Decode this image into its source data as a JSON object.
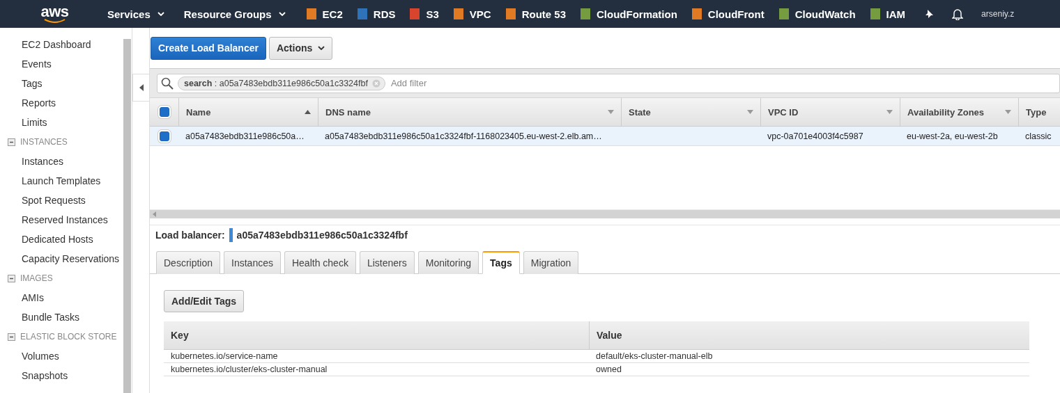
{
  "top_nav": {
    "logo": "aws",
    "menus": [
      {
        "label": "Services"
      },
      {
        "label": "Resource Groups"
      }
    ],
    "services": [
      {
        "label": "EC2",
        "color": "#e07b24"
      },
      {
        "label": "RDS",
        "color": "#2e73b8"
      },
      {
        "label": "S3",
        "color": "#d9442c"
      },
      {
        "label": "VPC",
        "color": "#e07b24"
      },
      {
        "label": "Route 53",
        "color": "#e07b24"
      },
      {
        "label": "CloudFormation",
        "color": "#759c3e"
      },
      {
        "label": "CloudFront",
        "color": "#e07b24"
      },
      {
        "label": "CloudWatch",
        "color": "#759c3e"
      },
      {
        "label": "IAM",
        "color": "#759c3e"
      }
    ],
    "user": "arseniy.z"
  },
  "sidebar": {
    "items": [
      {
        "kind": "link",
        "label": "EC2 Dashboard"
      },
      {
        "kind": "link",
        "label": "Events"
      },
      {
        "kind": "link",
        "label": "Tags"
      },
      {
        "kind": "link",
        "label": "Reports"
      },
      {
        "kind": "link",
        "label": "Limits"
      },
      {
        "kind": "section",
        "label": "INSTANCES"
      },
      {
        "kind": "link",
        "label": "Instances"
      },
      {
        "kind": "link",
        "label": "Launch Templates"
      },
      {
        "kind": "link",
        "label": "Spot Requests"
      },
      {
        "kind": "link",
        "label": "Reserved Instances"
      },
      {
        "kind": "link",
        "label": "Dedicated Hosts"
      },
      {
        "kind": "link",
        "label": "Capacity Reservations"
      },
      {
        "kind": "section",
        "label": "IMAGES"
      },
      {
        "kind": "link",
        "label": "AMIs"
      },
      {
        "kind": "link",
        "label": "Bundle Tasks"
      },
      {
        "kind": "section",
        "label": "ELASTIC BLOCK STORE"
      },
      {
        "kind": "link",
        "label": "Volumes"
      },
      {
        "kind": "link",
        "label": "Snapshots"
      }
    ]
  },
  "toolbar": {
    "primary_button": "Create Load Balancer",
    "actions_button": "Actions"
  },
  "filter": {
    "token_key": "search",
    "token_value": ": a05a7483ebdb311e986c50a1c3324fbf",
    "placeholder": "Add filter"
  },
  "table": {
    "select_all_checked": true,
    "columns": [
      {
        "label": "Name",
        "sorted": true
      },
      {
        "label": "DNS name",
        "sorted": false
      },
      {
        "label": "State",
        "sorted": false
      },
      {
        "label": "VPC ID",
        "sorted": false
      },
      {
        "label": "Availability Zones",
        "sorted": false
      },
      {
        "label": "Type"
      }
    ],
    "rows": [
      {
        "selected": true,
        "checked": true,
        "cells": [
          "a05a7483ebdb311e986c50a…",
          "a05a7483ebdb311e986c50a1c3324fbf-1168023405.eu-west-2.elb.am…",
          "",
          "vpc-0a701e4003f4c5987",
          "eu-west-2a, eu-west-2b",
          "classic"
        ]
      }
    ]
  },
  "details": {
    "label": "Load balancer:",
    "name": "a05a7483ebdb311e986c50a1c3324fbf",
    "tabs": [
      {
        "label": "Description",
        "selected": false
      },
      {
        "label": "Instances",
        "selected": false
      },
      {
        "label": "Health check",
        "selected": false
      },
      {
        "label": "Listeners",
        "selected": false
      },
      {
        "label": "Monitoring",
        "selected": false
      },
      {
        "label": "Tags",
        "selected": true
      },
      {
        "label": "Migration",
        "selected": false
      }
    ],
    "button": "Add/Edit Tags",
    "tags_table": {
      "columns": [
        "Key",
        "Value"
      ],
      "rows": [
        [
          "kubernetes.io/service-name",
          "default/eks-cluster-manual-elb"
        ],
        [
          "kubernetes.io/cluster/eks-cluster-manual",
          "owned"
        ]
      ]
    }
  }
}
